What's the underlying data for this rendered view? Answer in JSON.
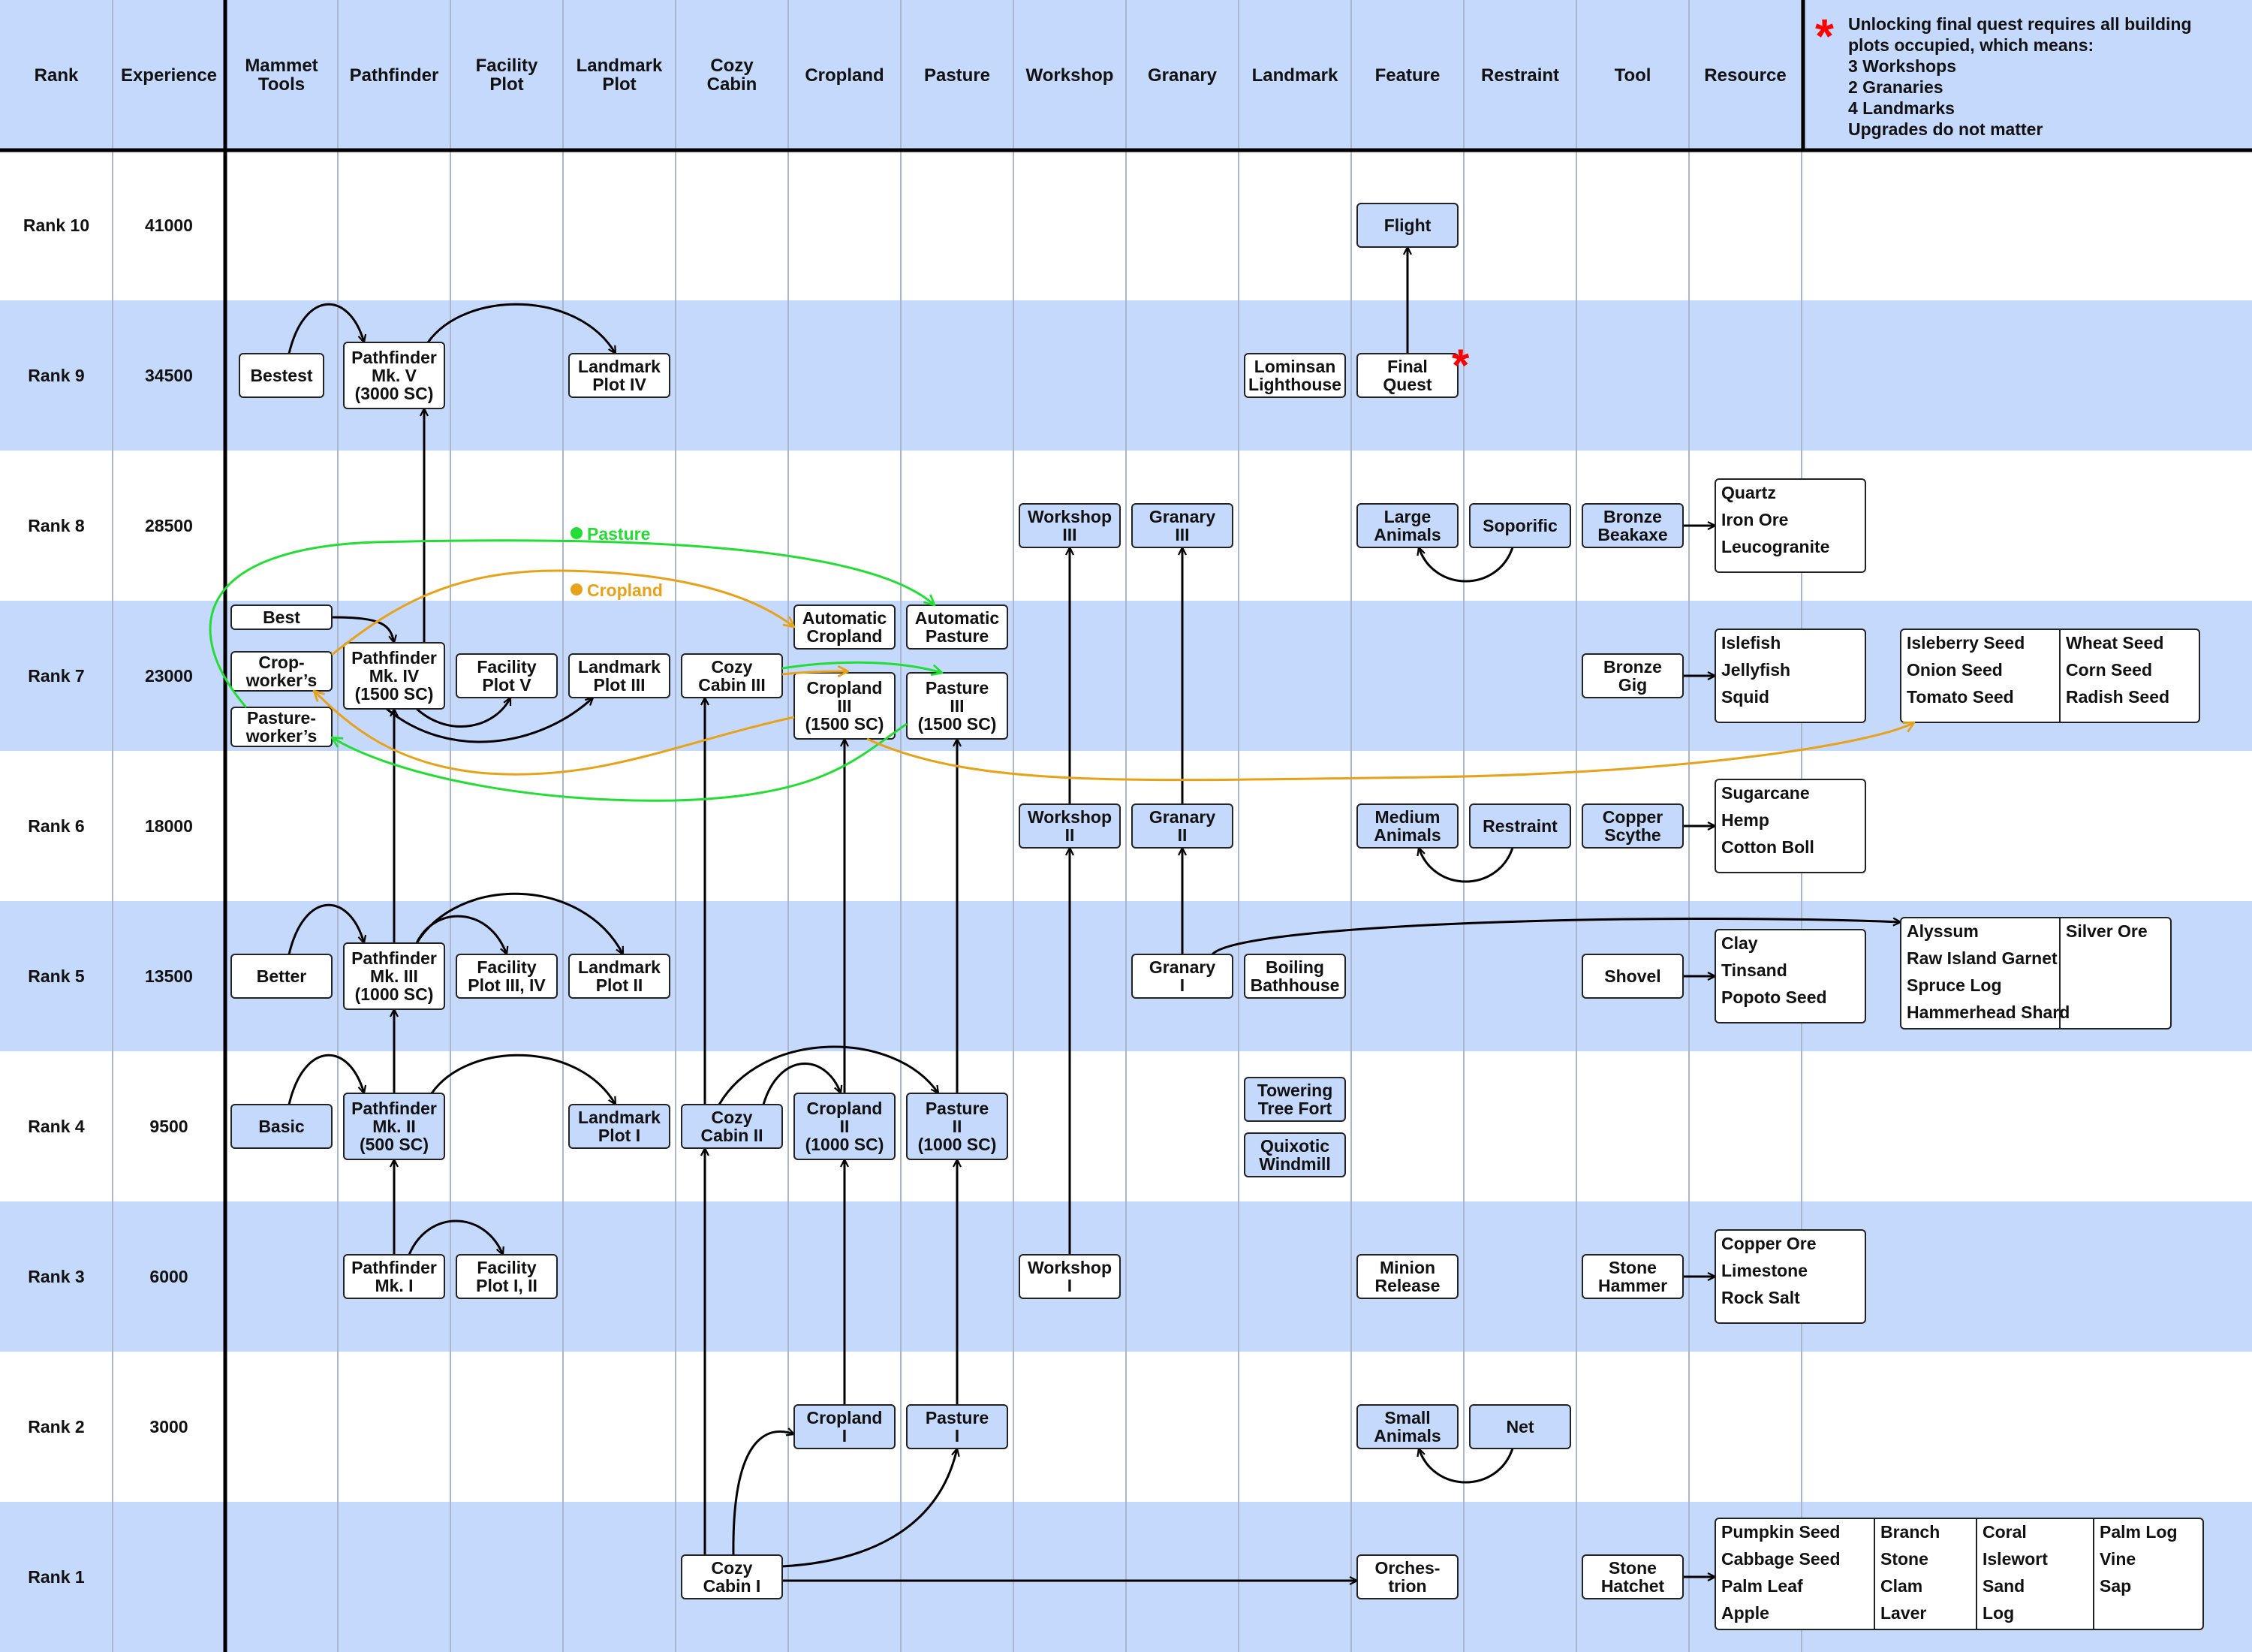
{
  "columns": [
    {
      "id": "rank",
      "label": [
        "Rank"
      ]
    },
    {
      "id": "experience",
      "label": [
        "Experience"
      ]
    },
    {
      "id": "mammet_tools",
      "label": [
        "Mammet",
        "Tools"
      ]
    },
    {
      "id": "pathfinder",
      "label": [
        "Pathfinder"
      ]
    },
    {
      "id": "facility_plot",
      "label": [
        "Facility",
        "Plot"
      ]
    },
    {
      "id": "landmark_plot",
      "label": [
        "Landmark",
        "Plot"
      ]
    },
    {
      "id": "cozy_cabin",
      "label": [
        "Cozy",
        "Cabin"
      ]
    },
    {
      "id": "cropland",
      "label": [
        "Cropland"
      ]
    },
    {
      "id": "pasture",
      "label": [
        "Pasture"
      ]
    },
    {
      "id": "workshop",
      "label": [
        "Workshop"
      ]
    },
    {
      "id": "granary",
      "label": [
        "Granary"
      ]
    },
    {
      "id": "landmark",
      "label": [
        "Landmark"
      ]
    },
    {
      "id": "feature",
      "label": [
        "Feature"
      ]
    },
    {
      "id": "restraint",
      "label": [
        "Restraint"
      ]
    },
    {
      "id": "tool",
      "label": [
        "Tool"
      ]
    },
    {
      "id": "resource",
      "label": [
        "Resource"
      ]
    }
  ],
  "note": {
    "marker": "*",
    "lines": [
      "Unlocking final quest requires all building",
      "plots occupied, which means:",
      "3 Workshops",
      "2 Granaries",
      "4 Landmarks",
      "Upgrades do not matter"
    ],
    "marker_color": "#ff0000"
  },
  "ranks": [
    {
      "rank": "Rank 10",
      "experience": "41000"
    },
    {
      "rank": "Rank 9",
      "experience": "34500"
    },
    {
      "rank": "Rank 8",
      "experience": "28500"
    },
    {
      "rank": "Rank 7",
      "experience": "23000"
    },
    {
      "rank": "Rank 6",
      "experience": "18000"
    },
    {
      "rank": "Rank 5",
      "experience": "13500"
    },
    {
      "rank": "Rank 4",
      "experience": "9500"
    },
    {
      "rank": "Rank 3",
      "experience": "6000"
    },
    {
      "rank": "Rank 2",
      "experience": "3000"
    },
    {
      "rank": "Rank 1",
      "experience": ""
    }
  ],
  "legend": [
    {
      "label": "Pasture",
      "color": "#22dd33"
    },
    {
      "label": "Cropland",
      "color": "#e8a21a"
    }
  ],
  "colors": {
    "row_blue": "#c5d9fd",
    "box_blue": "#c5d9fd",
    "box_white": "#ffffff",
    "pasture_line": "#22dd33",
    "cropland_line": "#e8a21a",
    "edge": "#000000"
  },
  "nodes": [
    {
      "id": "flight",
      "lines": [
        "Flight"
      ]
    },
    {
      "id": "bestest",
      "lines": [
        "Bestest"
      ]
    },
    {
      "id": "pf5",
      "lines": [
        "Pathfinder",
        "Mk. V",
        "(3000 SC)"
      ]
    },
    {
      "id": "lp4",
      "lines": [
        "Landmark",
        "Plot IV"
      ]
    },
    {
      "id": "lominsan",
      "lines": [
        "Lominsan",
        "Lighthouse"
      ]
    },
    {
      "id": "final_quest",
      "lines": [
        "Final",
        "Quest"
      ]
    },
    {
      "id": "ws3",
      "lines": [
        "Workshop",
        "III"
      ]
    },
    {
      "id": "gr3",
      "lines": [
        "Granary",
        "III"
      ]
    },
    {
      "id": "large_animals",
      "lines": [
        "Large",
        "Animals"
      ]
    },
    {
      "id": "soporific",
      "lines": [
        "Soporific"
      ]
    },
    {
      "id": "bronze_beakaxe",
      "lines": [
        "Bronze",
        "Beakaxe"
      ]
    },
    {
      "id": "best",
      "lines": [
        "Best"
      ]
    },
    {
      "id": "cropworkers",
      "lines": [
        "Crop-",
        "worker's"
      ]
    },
    {
      "id": "pastureworkers",
      "lines": [
        "Pasture-",
        "worker's"
      ]
    },
    {
      "id": "pf4",
      "lines": [
        "Pathfinder",
        "Mk. IV",
        "(1500 SC)"
      ]
    },
    {
      "id": "fp5",
      "lines": [
        "Facility",
        "Plot V"
      ]
    },
    {
      "id": "lp3",
      "lines": [
        "Landmark",
        "Plot III"
      ]
    },
    {
      "id": "cc3",
      "lines": [
        "Cozy",
        "Cabin III"
      ]
    },
    {
      "id": "auto_crop",
      "lines": [
        "Automatic",
        "Cropland"
      ]
    },
    {
      "id": "auto_pasture",
      "lines": [
        "Automatic",
        "Pasture"
      ]
    },
    {
      "id": "crop3",
      "lines": [
        "Cropland",
        "III",
        "(1500 SC)"
      ]
    },
    {
      "id": "pasture3",
      "lines": [
        "Pasture",
        "III",
        "(1500 SC)"
      ]
    },
    {
      "id": "bronze_gig",
      "lines": [
        "Bronze",
        "Gig"
      ]
    },
    {
      "id": "ws2",
      "lines": [
        "Workshop",
        "II"
      ]
    },
    {
      "id": "gr2",
      "lines": [
        "Granary",
        "II"
      ]
    },
    {
      "id": "medium_animals",
      "lines": [
        "Medium",
        "Animals"
      ]
    },
    {
      "id": "restraint",
      "lines": [
        "Restraint"
      ]
    },
    {
      "id": "copper_scythe",
      "lines": [
        "Copper",
        "Scythe"
      ]
    },
    {
      "id": "better",
      "lines": [
        "Better"
      ]
    },
    {
      "id": "pf3",
      "lines": [
        "Pathfinder",
        "Mk. III",
        "(1000 SC)"
      ]
    },
    {
      "id": "fp34",
      "lines": [
        "Facility",
        "Plot III, IV"
      ]
    },
    {
      "id": "lp2",
      "lines": [
        "Landmark",
        "Plot II"
      ]
    },
    {
      "id": "gr1",
      "lines": [
        "Granary",
        "I"
      ]
    },
    {
      "id": "boiling",
      "lines": [
        "Boiling",
        "Bathhouse"
      ]
    },
    {
      "id": "shovel",
      "lines": [
        "Shovel"
      ]
    },
    {
      "id": "basic",
      "lines": [
        "Basic"
      ]
    },
    {
      "id": "pf2",
      "lines": [
        "Pathfinder",
        "Mk. II",
        "(500 SC)"
      ]
    },
    {
      "id": "lp1",
      "lines": [
        "Landmark",
        "Plot I"
      ]
    },
    {
      "id": "cc2",
      "lines": [
        "Cozy",
        "Cabin II"
      ]
    },
    {
      "id": "crop2",
      "lines": [
        "Cropland",
        "II",
        "(1000 SC)"
      ]
    },
    {
      "id": "pasture2",
      "lines": [
        "Pasture",
        "II",
        "(1000 SC)"
      ]
    },
    {
      "id": "towering",
      "lines": [
        "Towering",
        "Tree Fort"
      ]
    },
    {
      "id": "quixotic",
      "lines": [
        "Quixotic",
        "Windmill"
      ]
    },
    {
      "id": "pf1",
      "lines": [
        "Pathfinder",
        "Mk. I"
      ]
    },
    {
      "id": "fp12",
      "lines": [
        "Facility",
        "Plot I, II"
      ]
    },
    {
      "id": "ws1",
      "lines": [
        "Workshop",
        "I"
      ]
    },
    {
      "id": "minion_release",
      "lines": [
        "Minion",
        "Release"
      ]
    },
    {
      "id": "stone_hammer",
      "lines": [
        "Stone",
        "Hammer"
      ]
    },
    {
      "id": "crop1",
      "lines": [
        "Cropland",
        "I"
      ]
    },
    {
      "id": "pasture1",
      "lines": [
        "Pasture",
        "I"
      ]
    },
    {
      "id": "small_animals",
      "lines": [
        "Small",
        "Animals"
      ]
    },
    {
      "id": "net",
      "lines": [
        "Net"
      ]
    },
    {
      "id": "cc1",
      "lines": [
        "Cozy",
        "Cabin I"
      ]
    },
    {
      "id": "orchestrion",
      "lines": [
        "Orches-",
        "trion"
      ]
    },
    {
      "id": "stone_hatchet",
      "lines": [
        "Stone",
        "Hatchet"
      ]
    }
  ],
  "resources": [
    {
      "id": "res8",
      "columns": [
        [
          "Quartz",
          "Iron Ore",
          "Leucogranite"
        ]
      ]
    },
    {
      "id": "res7a",
      "columns": [
        [
          "Islefish",
          "Jellyfish",
          "Squid"
        ]
      ]
    },
    {
      "id": "res7b",
      "columns": [
        [
          "Isleberry Seed",
          "Onion Seed",
          "Tomato Seed"
        ],
        [
          "Wheat Seed",
          "Corn Seed",
          "Radish Seed"
        ]
      ]
    },
    {
      "id": "res6",
      "columns": [
        [
          "Sugarcane",
          "Hemp",
          "Cotton Boll"
        ]
      ]
    },
    {
      "id": "res5a",
      "columns": [
        [
          "Clay",
          "Tinsand",
          "Popoto Seed"
        ]
      ]
    },
    {
      "id": "res5b",
      "columns": [
        [
          "Alyssum",
          "Raw Island Garnet",
          "Spruce Log",
          "Hammerhead Shard"
        ],
        [
          "Silver Ore"
        ]
      ]
    },
    {
      "id": "res3",
      "columns": [
        [
          "Copper Ore",
          "Limestone",
          "Rock Salt"
        ]
      ]
    },
    {
      "id": "res1",
      "columns": [
        [
          "Pumpkin Seed",
          "Cabbage Seed",
          "Palm Leaf",
          "Apple"
        ],
        [
          "Branch",
          "Stone",
          "Clam",
          "Laver"
        ],
        [
          "Coral",
          "Islewort",
          "Sand",
          "Log"
        ],
        [
          "Palm Log",
          "Vine",
          "Sap"
        ]
      ]
    }
  ]
}
